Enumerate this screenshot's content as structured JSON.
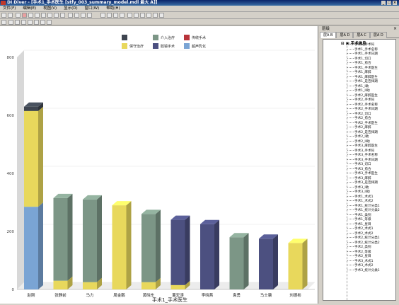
{
  "window": {
    "title": "DI Diver - [手术1_手术医生 [stfy_003_summary_model.mdl 最大 A]]",
    "minimize": "_",
    "maximize": "□",
    "close": "×"
  },
  "menu": [
    "文件(F)",
    "编辑(E)",
    "视图(V)",
    "显示(D)",
    "窗口(W)",
    "帮助(H)"
  ],
  "panel": {
    "title": "层级",
    "close": "×",
    "tabs": [
      "层A B",
      "层A D",
      "层A C",
      "层A D"
    ],
    "root": "⊟ ▣ 手术信息",
    "items": [
      "手术1_手术码",
      "手术1_手术名称",
      "手术1_手术日期",
      "手术1_切口",
      "手术1_愈合",
      "手术1_手术医生",
      "手术1_麻醉",
      "手术1_麻醉医生",
      "手术1_是否择期",
      "手术1_I助",
      "手术1_II助",
      "手术2_麻醉医生",
      "手术2_手术码",
      "手术2_手术名称",
      "手术2_手术日期",
      "手术2_切口",
      "手术2_愈合",
      "手术2_手术医生",
      "手术2_麻醉",
      "手术2_是否择期",
      "手术2_I助",
      "手术2_II助",
      "手术3_麻醉医生",
      "手术3_手术码",
      "手术3_手术名称",
      "手术3_手术日期",
      "手术3_切口",
      "手术3_愈合",
      "手术3_手术医生",
      "手术3_麻醉",
      "手术3_是否择期",
      "手术3_I助",
      "手术3_II助",
      "手术1_术式1",
      "手术1_术式2",
      "手术1_统计分类1",
      "手术1_统计分类2",
      "手术1_类别",
      "手术1_等级",
      "手术1_星目",
      "手术2_术式1",
      "手术2_术式2",
      "手术2_统计分类1",
      "手术2_统计分类2",
      "手术2_类别",
      "手术2_等级",
      "手术2_星目",
      "手术3_术式1",
      "手术3_术式2",
      "手术3_统计分类1"
    ]
  },
  "chart_data": {
    "type": "bar",
    "stacked": true,
    "xlabel": "手术1_手术医生",
    "ylabel": "",
    "ylim": [
      0,
      800
    ],
    "yticks": [
      "0",
      "200",
      "400",
      "600",
      "800"
    ],
    "categories": [
      "赵刚",
      "张静前",
      "马力",
      "周金鹏",
      "黄晓东",
      "董宏涛",
      "李晓燕",
      "袁勇",
      "马士骥",
      "刘德彬"
    ],
    "legend_position": "top-center",
    "series": [
      {
        "name": "",
        "color": "#3e4550",
        "values": [
          15,
          0,
          0,
          0,
          0,
          0,
          0,
          0,
          0,
          0
        ]
      },
      {
        "name": "介入治疗",
        "color": "#7c9686",
        "values": [
          0,
          285,
          285,
          0,
          235,
          0,
          0,
          180,
          0,
          0
        ]
      },
      {
        "name": "传统手术",
        "color": "#b8343a",
        "values": [
          0,
          0,
          0,
          0,
          0,
          0,
          0,
          0,
          0,
          0
        ]
      },
      {
        "name": "保守治疗",
        "color": "#e8d85c",
        "values": [
          330,
          30,
          25,
          290,
          25,
          15,
          0,
          0,
          0,
          160
        ]
      },
      {
        "name": "腔镜手术",
        "color": "#4c5080",
        "values": [
          0,
          0,
          0,
          0,
          0,
          225,
          225,
          0,
          175,
          0
        ]
      },
      {
        "name": "超声乳化",
        "color": "#7aa4d4",
        "values": [
          285,
          0,
          0,
          0,
          0,
          0,
          0,
          0,
          0,
          0
        ]
      }
    ],
    "stack_order": [
      5,
      3,
      1,
      4,
      0
    ],
    "legend": [
      {
        "label": "",
        "color": "#3e4550"
      },
      {
        "label": "介入治疗",
        "color": "#7c9686"
      },
      {
        "label": "传统手术",
        "color": "#b8343a"
      },
      {
        "label": "保守治疗",
        "color": "#e8d85c"
      },
      {
        "label": "腔镜手术",
        "color": "#4c5080"
      },
      {
        "label": "超声乳化",
        "color": "#7aa4d4"
      }
    ]
  }
}
